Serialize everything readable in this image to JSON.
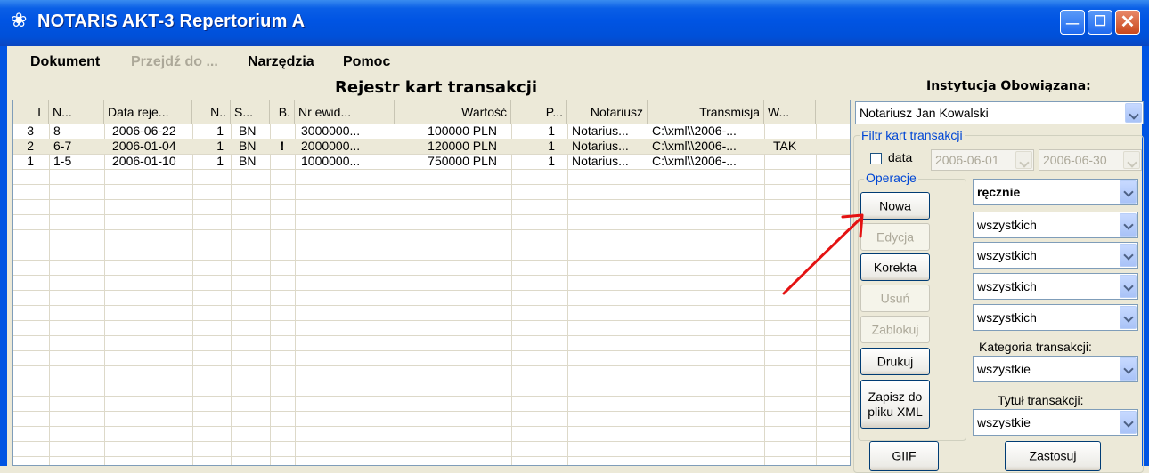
{
  "window": {
    "title": "NOTARIS AKT-3 Repertorium A",
    "app_icon": "flower-icon",
    "colors": {
      "titlebar": "#0054e3",
      "close": "#c9471c",
      "face": "#ece9d8",
      "group_label": "#0046d5"
    }
  },
  "menu": {
    "dokument": "Dokument",
    "przejdz": "Przejdź do ...",
    "narzedzia": "Narzędzia",
    "pomoc": "Pomoc"
  },
  "register": {
    "title": "Rejestr kart transakcji",
    "columns": [
      "L",
      "N...",
      "Data reje...",
      "N..",
      "S...",
      "B.",
      "Nr ewid...",
      "Wartość",
      "P...",
      "Notariusz",
      "Transmisja",
      "W..."
    ],
    "rows": [
      {
        "l": "3",
        "n": "8",
        "date": "2006-06-22",
        "n2": "1",
        "s": "BN",
        "b": "",
        "nr": "3000000...",
        "value": "100000 PLN",
        "p": "1",
        "notary": "Notarius...",
        "transmission": "C:\\xml\\\\2006-...",
        "w": ""
      },
      {
        "l": "2",
        "n": "6-7",
        "date": "2006-01-04",
        "n2": "1",
        "s": "BN",
        "b": "!",
        "nr": "2000000...",
        "value": "120000 PLN",
        "p": "1",
        "notary": "Notarius...",
        "transmission": "C:\\xml\\\\2006-...",
        "w": "TAK"
      },
      {
        "l": "1",
        "n": "1-5",
        "date": "2006-01-10",
        "n2": "1",
        "s": "BN",
        "b": "",
        "nr": "1000000...",
        "value": "750000 PLN",
        "p": "1",
        "notary": "Notarius...",
        "transmission": "C:\\xml\\\\2006-...",
        "w": ""
      }
    ]
  },
  "side": {
    "institution_label": "Instytucja Obowiązana:",
    "institution_value": "Notariusz Jan Kowalski",
    "filter_label": "Filtr kart transakcji",
    "date_label": "data",
    "date_from": "2006-06-01",
    "date_to": "2006-06-30",
    "ops_label": "Operacje",
    "buttons": {
      "new": "Nowa",
      "edit": "Edycja",
      "correct": "Korekta",
      "delete": "Usuń",
      "lock": "Zablokuj",
      "print": "Drukuj",
      "save_xml": "Zapisz do\npliku XML",
      "giif": "GIIF",
      "apply": "Zastosuj"
    },
    "filters": {
      "mode": "ręcznie",
      "f1": "wszystkich",
      "f2": "wszystkich",
      "f3": "wszystkich",
      "f4": "wszystkich",
      "category_label": "Kategoria transakcji:",
      "category": "wszystkie",
      "title_label": "Tytuł transakcji:",
      "title": "wszystkie"
    }
  }
}
